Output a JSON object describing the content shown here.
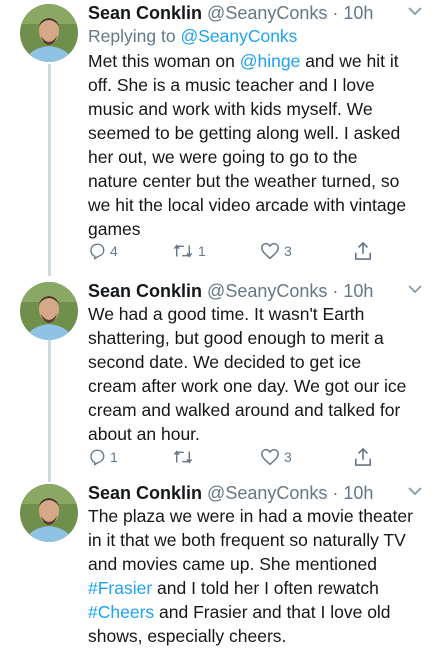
{
  "tweets": [
    {
      "name": "Sean Conklin",
      "handle": "@SeanyConks",
      "time": "10h",
      "reply_prefix": "Replying to",
      "reply_to": "@SeanyConks",
      "body_lines": [
        {
          "pre": "Met this woman on ",
          "link": "@hinge",
          "post": " and we hit it"
        },
        {
          "pre": "off. She is a music teacher and I love",
          "link": "",
          "post": ""
        },
        {
          "pre": "music and work with kids myself. We",
          "link": "",
          "post": ""
        },
        {
          "pre": "seemed to be getting along well. I asked",
          "link": "",
          "post": ""
        },
        {
          "pre": "her out, we were going to go to the",
          "link": "",
          "post": ""
        },
        {
          "pre": "nature center but the weather turned, so",
          "link": "",
          "post": ""
        },
        {
          "pre": "we hit the local video arcade with vintage",
          "link": "",
          "post": ""
        },
        {
          "pre": "games",
          "link": "",
          "post": ""
        }
      ],
      "replies": "4",
      "retweets": "1",
      "likes": "3"
    },
    {
      "name": "Sean Conklin",
      "handle": "@SeanyConks",
      "time": "10h",
      "body_lines": [
        {
          "pre": "We had a good time. It wasn't Earth",
          "link": "",
          "post": ""
        },
        {
          "pre": "shattering, but good enough to merit a",
          "link": "",
          "post": ""
        },
        {
          "pre": "second date. We decided to get ice",
          "link": "",
          "post": ""
        },
        {
          "pre": "cream after work one day. We got our ice",
          "link": "",
          "post": ""
        },
        {
          "pre": "cream and walked around and talked for",
          "link": "",
          "post": ""
        },
        {
          "pre": "about an hour.",
          "link": "",
          "post": ""
        }
      ],
      "replies": "1",
      "retweets": "",
      "likes": "3"
    },
    {
      "name": "Sean Conklin",
      "handle": "@SeanyConks",
      "time": "10h",
      "body_lines": [
        {
          "pre": "The plaza we were in had a movie theater",
          "link": "",
          "post": ""
        },
        {
          "pre": "in it that we both frequent so naturally TV",
          "link": "",
          "post": ""
        },
        {
          "pre": "and movies came up. She mentioned",
          "link": "",
          "post": ""
        },
        {
          "pre": "",
          "link": "#Frasier",
          "post": " and I told her I often rewatch"
        },
        {
          "pre": "",
          "link": "#Cheers",
          "post": " and Frasier and that I love old"
        },
        {
          "pre": "shows, especially cheers.",
          "link": "",
          "post": ""
        }
      ]
    }
  ],
  "colors": {
    "text": "#14171a",
    "secondary": "#657786",
    "link": "#1da1f2",
    "thread_line": "#cfd9de"
  }
}
